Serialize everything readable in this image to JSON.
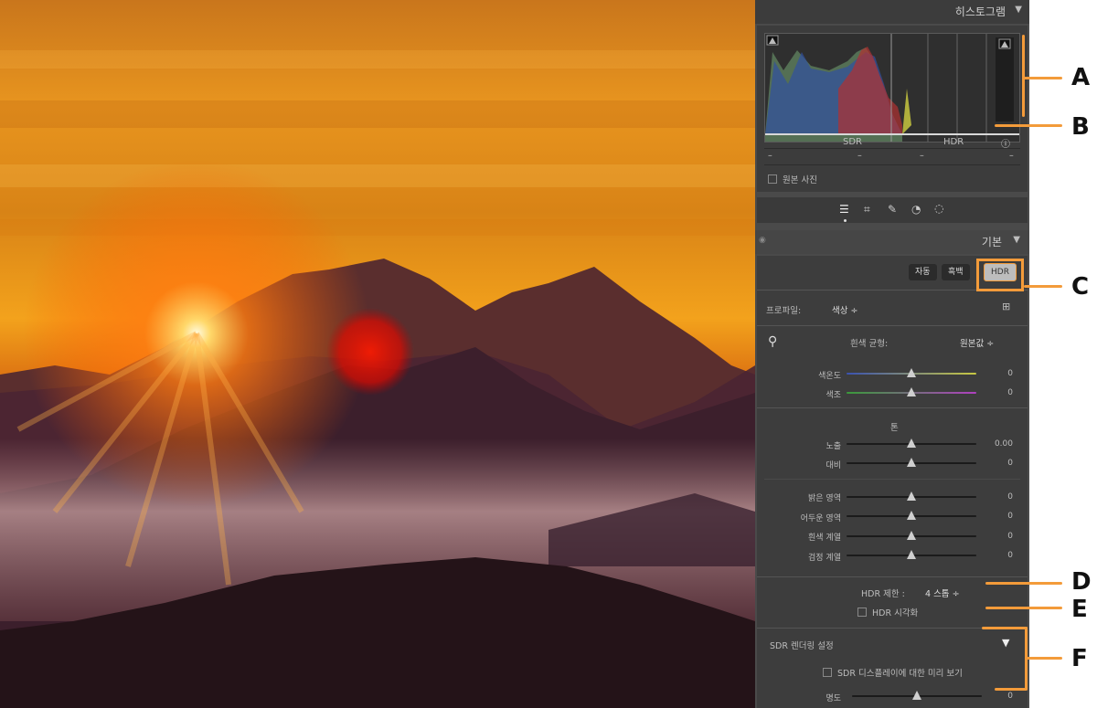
{
  "histogram": {
    "title": "히스토그램",
    "sdr_label": "SDR",
    "hdr_label": "HDR",
    "readouts": [
      "–",
      "–",
      "–",
      "–"
    ],
    "original_photo_label": "원본 사진"
  },
  "basic": {
    "title": "기본",
    "buttons": {
      "auto": "자동",
      "bw": "흑백",
      "hdr": "HDR"
    },
    "profile_label": "프로파일:",
    "profile_value": "색상 ÷",
    "wb_label": "흰색 균형:",
    "wb_value": "원본값 ÷",
    "sliders": [
      {
        "label": "색온도",
        "value": "0",
        "level": 0.5
      },
      {
        "label": "색조",
        "value": "0",
        "level": 0.5
      },
      {
        "label": "노출",
        "value": "0.00",
        "level": 0.5
      },
      {
        "label": "대비",
        "value": "0",
        "level": 0.5
      },
      {
        "label": "밝은 영역",
        "value": "0",
        "level": 0.5
      },
      {
        "label": "어두운 영역",
        "value": "0",
        "level": 0.5
      },
      {
        "label": "흰색 계열",
        "value": "0",
        "level": 0.5
      },
      {
        "label": "검정 계열",
        "value": "0",
        "level": 0.5
      },
      {
        "label": "명도",
        "value": "0",
        "level": 0.5
      }
    ],
    "tone_label": "톤",
    "hdr_limit_label": "HDR 제한 :",
    "hdr_limit_value": "4 스톱 ÷",
    "hdr_visualize_label": "HDR 시각화",
    "sdr_render_label": "SDR 렌더링 설정",
    "sdr_preview_label": "SDR 디스플레이에 대한 미리 보기"
  },
  "callouts": [
    "A",
    "B",
    "C",
    "D",
    "E",
    "F"
  ],
  "colors": {
    "accent": "#f39b3a",
    "panel": "#4a4a4a",
    "section": "#3d3d3d"
  }
}
